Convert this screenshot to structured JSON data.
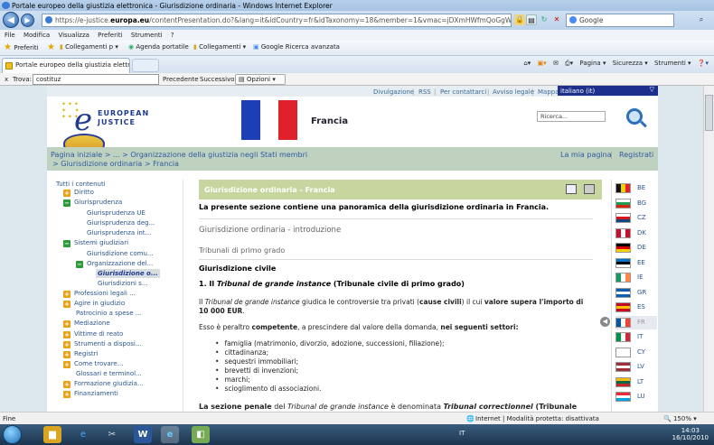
{
  "window": {
    "title": "Portale europeo della giustizia elettronica - Giurisdizione ordinaria - Windows Internet Explorer"
  },
  "address": {
    "domain_prefix": "https://e-justice.",
    "domain": "europa.eu",
    "rest": "/contentPresentation.do?&lang=it&idCountry=fr&idTaxonomy=18&member=1&vmac=jDXmHWfmQoGgW0C_0WO2OSpRVjWM",
    "search_placeholder": "Google"
  },
  "menu": [
    "File",
    "Modifica",
    "Visualizza",
    "Preferiti",
    "Strumenti",
    "?"
  ],
  "favorites": {
    "label": "Preferiti",
    "items": [
      "Collegamenti p ▾",
      "Agenda portatile",
      "Collegamenti ▾",
      "Google Ricerca avanzata"
    ]
  },
  "tab": {
    "title": "Portale europeo della giustizia elettro..."
  },
  "commandbar": [
    "Pagina ▾",
    "Sicurezza ▾",
    "Strumenti ▾"
  ],
  "find": {
    "close": "x",
    "label": "Trova:",
    "value": "costituz",
    "prev": "Precedente",
    "next": "Successivo",
    "options": "Opzioni"
  },
  "site": {
    "toplinks": [
      "Divulgazione",
      "RSS",
      "Per contattarci",
      "Avviso legale",
      "Mappa del sito"
    ],
    "separator": "|",
    "language": "italiano (it)",
    "logo_top": "EUROPEAN",
    "logo_bottom": "JUSTICE",
    "country": "Francia",
    "search_placeholder": "Ricerca...",
    "breadcrumb1": "Pagina iniziale  >  ...  >  Organizzazione della giustizia negli Stati membri",
    "breadcrumb2": ">  Giurisdizione ordinaria  >  Francia",
    "my_page": "La mia pagina",
    "register": "Registrati",
    "nav": {
      "all": "Tutti i contenuti",
      "items": [
        "Diritto",
        "Giurisprudenza",
        "Giurisprudenza UE",
        "Giurisprudenza deg...",
        "Giurisprudenza int...",
        "Sistemi giudiziari",
        "Giurisdizione comu...",
        "Organizzazione del...",
        "Giurisdizione o...",
        "Giurisdizioni s...",
        "Professioni legali ...",
        "Agire in giudizio",
        "Patrocinio a spese ...",
        "Mediazione",
        "Vittime di reato",
        "Strumenti a disposi...",
        "Registri",
        "Come trovare...",
        "Glossari e terminol...",
        "Formazione giudizia...",
        "Finanziamenti"
      ]
    },
    "content": {
      "header": "Giurisdizione ordinaria - Francia",
      "intro": "La presente sezione contiene una panoramica della giurisdizione ordinaria in Francia.",
      "h2": "Giurisdizione ordinaria - introduzione",
      "h3": "Tribunali di primo grado",
      "h4": "Giurisdizione civile",
      "h5_num": "1. Il ",
      "h5_em": "Tribunal de grande instance",
      "h5_rest": " (Tribunale civile di primo grado)",
      "p1_a": "Il ",
      "p1_em": "Tribunal de grande instance",
      "p1_b": " giudica le controversie tra privati (",
      "p1_bold1": "cause civili",
      "p1_c": ") il cui ",
      "p1_bold2": "valore supera l'importo di",
      "p1_line2": "10 000 EUR",
      "p1_end": ".",
      "p2_a": "Esso è peraltro ",
      "p2_bold1": "competente",
      "p2_b": ", a prescindere dal valore della domanda, ",
      "p2_bold2": "nei seguenti settori:",
      "bullets": [
        "famiglia (matrimonio, divorzio, adozione, successioni, filiazione);",
        "cittadinanza;",
        "sequestri immobiliari;",
        "brevetti di invenzioni;",
        "marchi;",
        "scioglimento di associazioni."
      ],
      "p3_a": "La sezione penale",
      "p3_b": " del ",
      "p3_em": "Tribunal de grande instance",
      "p3_c": " è denominata ",
      "p3_em2": "Tribunal correctionnel",
      "p3_d": " (Tribunale"
    },
    "flags": [
      {
        "code": "BE",
        "colors": [
          "#111111",
          "#f5d000",
          "#e3202c"
        ],
        "dir": "v"
      },
      {
        "code": "BG",
        "colors": [
          "#ffffff",
          "#1f9c4f",
          "#d62612"
        ],
        "dir": "h"
      },
      {
        "code": "CZ",
        "colors": [
          "#ffffff",
          "#d7141a",
          "#11457e"
        ],
        "dir": "hcz"
      },
      {
        "code": "DK",
        "colors": [
          "#c8102e",
          "#ffffff",
          "#c8102e"
        ],
        "dir": "dk"
      },
      {
        "code": "DE",
        "colors": [
          "#000000",
          "#dd0000",
          "#ffce00"
        ],
        "dir": "h"
      },
      {
        "code": "EE",
        "colors": [
          "#0072ce",
          "#000000",
          "#ffffff"
        ],
        "dir": "h"
      },
      {
        "code": "IE",
        "colors": [
          "#169b62",
          "#ffffff",
          "#ff883e"
        ],
        "dir": "v"
      },
      {
        "code": "GR",
        "colors": [
          "#0d5eaf",
          "#ffffff",
          "#0d5eaf"
        ],
        "dir": "h"
      },
      {
        "code": "ES",
        "colors": [
          "#c60b1e",
          "#ffc400",
          "#c60b1e"
        ],
        "dir": "h"
      },
      {
        "code": "FR",
        "colors": [
          "#0055a4",
          "#ffffff",
          "#ef4135"
        ],
        "dir": "v"
      },
      {
        "code": "IT",
        "colors": [
          "#009246",
          "#ffffff",
          "#ce2b37"
        ],
        "dir": "v"
      },
      {
        "code": "CY",
        "colors": [
          "#ffffff",
          "#ffffff",
          "#ffffff"
        ],
        "dir": "v"
      },
      {
        "code": "LV",
        "colors": [
          "#9e3039",
          "#ffffff",
          "#9e3039"
        ],
        "dir": "h"
      },
      {
        "code": "LT",
        "colors": [
          "#fdb913",
          "#006a44",
          "#c1272d"
        ],
        "dir": "h"
      },
      {
        "code": "LU",
        "colors": [
          "#ed2939",
          "#ffffff",
          "#00a1de"
        ],
        "dir": "h"
      }
    ]
  },
  "status": {
    "left": "Fine",
    "zone": "Internet | Modalità protetta: disattivata",
    "zoom": "150%"
  },
  "taskbar": {
    "lang": "IT",
    "time": "14:03",
    "date": "16/10/2010"
  }
}
